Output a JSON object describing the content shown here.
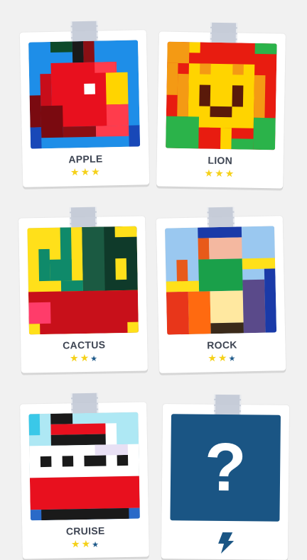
{
  "puzzles": [
    {
      "title": "APPLE",
      "stars": 3
    },
    {
      "title": "LION",
      "stars": 3
    },
    {
      "title": "CACTUS",
      "stars": 2
    },
    {
      "title": "ROCK",
      "stars": 2
    },
    {
      "title": "CRUISE",
      "stars": 2
    }
  ],
  "locked": {
    "symbol": "?"
  },
  "colors": {
    "star_filled": "#f5d11a",
    "star_empty": "#1f5a8a",
    "locked_bg": "#1a5584"
  }
}
